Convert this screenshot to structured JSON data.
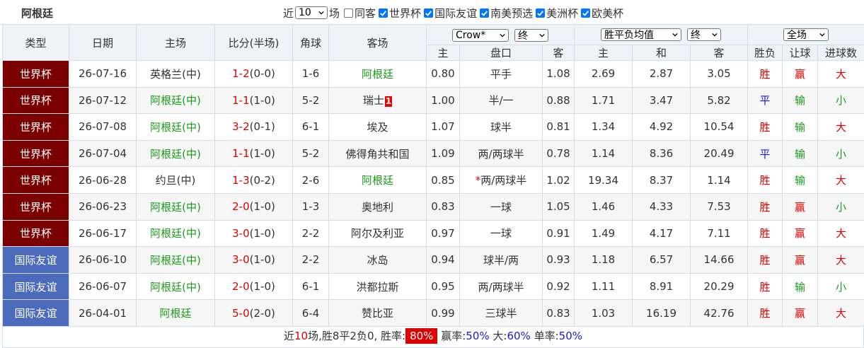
{
  "team": "阿根廷",
  "filters": {
    "recent_label": "近",
    "recent_count": "10",
    "games_label": "场",
    "same_home_label": "同客",
    "competitions": [
      {
        "label": "世界杯",
        "checked": true
      },
      {
        "label": "国际友谊",
        "checked": true
      },
      {
        "label": "南美预选",
        "checked": true
      },
      {
        "label": "美洲杯",
        "checked": true
      },
      {
        "label": "欧美杯",
        "checked": true
      }
    ]
  },
  "headers": {
    "type": "类型",
    "date": "日期",
    "home": "主场",
    "score": "比分(半场)",
    "corners": "角球",
    "away": "客场",
    "handicap_company": "Crow*",
    "handicap_time": "终",
    "odds_kind": "胜平负均值",
    "odds_time": "终",
    "result_scope": "全场",
    "sub_home": "主",
    "sub_line": "盘口",
    "sub_away": "客",
    "sub_win": "主",
    "sub_draw": "和",
    "sub_lose": "客",
    "sub_result": "胜负",
    "sub_handicap": "让球",
    "sub_goals": "进球数"
  },
  "rows": [
    {
      "type": "世界杯",
      "kind": "wc",
      "date": "26-07-16",
      "home": "英格兰(中)",
      "home_hl": false,
      "score": "1-2",
      "half": "(0-0)",
      "corners": "1-6",
      "away": "阿根廷",
      "away_hl": true,
      "ah_home": "0.80",
      "line": "平手",
      "ah_away": "1.08",
      "w": "2.69",
      "d": "2.87",
      "l": "3.05",
      "res": "胜",
      "res_c": "red",
      "hc": "赢",
      "hc_c": "red",
      "goals": "大",
      "goals_c": "red"
    },
    {
      "type": "世界杯",
      "kind": "wc",
      "date": "26-07-12",
      "home": "阿根廷(中)",
      "home_hl": true,
      "score": "1-1",
      "half": "(1-0)",
      "corners": "5-2",
      "away": "瑞士",
      "away_badge": "1",
      "away_hl": false,
      "ah_home": "1.00",
      "line": "半/一",
      "ah_away": "0.88",
      "w": "1.71",
      "d": "3.47",
      "l": "5.82",
      "res": "平",
      "res_c": "blue",
      "hc": "输",
      "hc_c": "green",
      "goals": "小",
      "goals_c": "green"
    },
    {
      "type": "世界杯",
      "kind": "wc",
      "date": "26-07-08",
      "home": "阿根廷(中)",
      "home_hl": true,
      "score": "3-2",
      "half": "(0-1)",
      "corners": "6-1",
      "away": "埃及",
      "away_hl": false,
      "ah_home": "1.07",
      "line": "球半",
      "ah_away": "0.81",
      "w": "1.34",
      "d": "4.92",
      "l": "10.54",
      "res": "胜",
      "res_c": "red",
      "hc": "输",
      "hc_c": "green",
      "goals": "大",
      "goals_c": "red"
    },
    {
      "type": "世界杯",
      "kind": "wc",
      "date": "26-07-04",
      "home": "阿根廷(中)",
      "home_hl": true,
      "score": "1-1",
      "half": "(1-0)",
      "corners": "5-2",
      "away": "佛得角共和国",
      "away_hl": false,
      "ah_home": "1.09",
      "line": "两/两球半",
      "ah_away": "0.78",
      "w": "1.14",
      "d": "8.36",
      "l": "20.49",
      "res": "平",
      "res_c": "blue",
      "hc": "输",
      "hc_c": "green",
      "goals": "小",
      "goals_c": "green"
    },
    {
      "type": "世界杯",
      "kind": "wc",
      "date": "26-06-28",
      "home": "约旦(中)",
      "home_hl": false,
      "score": "1-3",
      "half": "(0-2)",
      "corners": "2-6",
      "away": "阿根廷",
      "away_hl": true,
      "ah_home": "0.85",
      "line": "两/两球半",
      "line_star": "*",
      "ah_away": "1.02",
      "w": "19.34",
      "d": "8.37",
      "l": "1.14",
      "res": "胜",
      "res_c": "red",
      "hc": "输",
      "hc_c": "green",
      "goals": "大",
      "goals_c": "red"
    },
    {
      "type": "世界杯",
      "kind": "wc",
      "date": "26-06-23",
      "home": "阿根廷(中)",
      "home_hl": true,
      "score": "2-0",
      "half": "(1-0)",
      "corners": "1-3",
      "away": "奥地利",
      "away_hl": false,
      "ah_home": "0.83",
      "line": "一球",
      "ah_away": "1.05",
      "w": "1.46",
      "d": "4.33",
      "l": "7.53",
      "res": "胜",
      "res_c": "red",
      "hc": "赢",
      "hc_c": "red",
      "goals": "小",
      "goals_c": "green"
    },
    {
      "type": "世界杯",
      "kind": "wc",
      "date": "26-06-17",
      "home": "阿根廷(中)",
      "home_hl": true,
      "score": "3-0",
      "half": "(1-0)",
      "corners": "2-2",
      "away": "阿尔及利亚",
      "away_hl": false,
      "ah_home": "0.97",
      "line": "一球",
      "ah_away": "0.91",
      "w": "1.49",
      "d": "4.17",
      "l": "7.11",
      "res": "胜",
      "res_c": "red",
      "hc": "赢",
      "hc_c": "red",
      "goals": "大",
      "goals_c": "red"
    },
    {
      "type": "国际友谊",
      "kind": "fr",
      "date": "26-06-10",
      "home": "阿根廷(中)",
      "home_hl": true,
      "score": "3-0",
      "half": "(1-0)",
      "corners": "2-2",
      "away": "冰岛",
      "away_hl": false,
      "ah_home": "0.94",
      "line": "球半/两",
      "ah_away": "0.93",
      "w": "1.18",
      "d": "6.57",
      "l": "14.66",
      "res": "胜",
      "res_c": "red",
      "hc": "赢",
      "hc_c": "red",
      "goals": "大",
      "goals_c": "red"
    },
    {
      "type": "国际友谊",
      "kind": "fr",
      "date": "26-06-07",
      "home": "阿根廷(中)",
      "home_hl": true,
      "score": "2-0",
      "half": "(1-0)",
      "corners": "6-1",
      "away": "洪都拉斯",
      "away_hl": false,
      "ah_home": "0.95",
      "line": "两/两球半",
      "ah_away": "0.92",
      "w": "1.11",
      "d": "8.91",
      "l": "20.29",
      "res": "胜",
      "res_c": "red",
      "hc": "输",
      "hc_c": "green",
      "goals": "小",
      "goals_c": "green"
    },
    {
      "type": "国际友谊",
      "kind": "fr",
      "date": "26-04-01",
      "home": "阿根廷",
      "home_hl": true,
      "score": "5-0",
      "half": "(2-0)",
      "corners": "6-4",
      "away": "赞比亚",
      "away_hl": false,
      "ah_home": "0.99",
      "line": "三球半",
      "ah_away": "0.83",
      "w": "1.03",
      "d": "16.19",
      "l": "42.76",
      "res": "胜",
      "res_c": "red",
      "hc": "赢",
      "hc_c": "red",
      "goals": "大",
      "goals_c": "red"
    }
  ],
  "summary": {
    "prefix": "近",
    "count": "10",
    "mid": "场,胜8平2负0, 胜率:",
    "win_rate": "80%",
    "hc_label": "赢率:",
    "hc_rate": "50%",
    "over_label": "大:",
    "over_rate": "60%",
    "odd_label": "单率:",
    "odd_rate": "50%"
  }
}
